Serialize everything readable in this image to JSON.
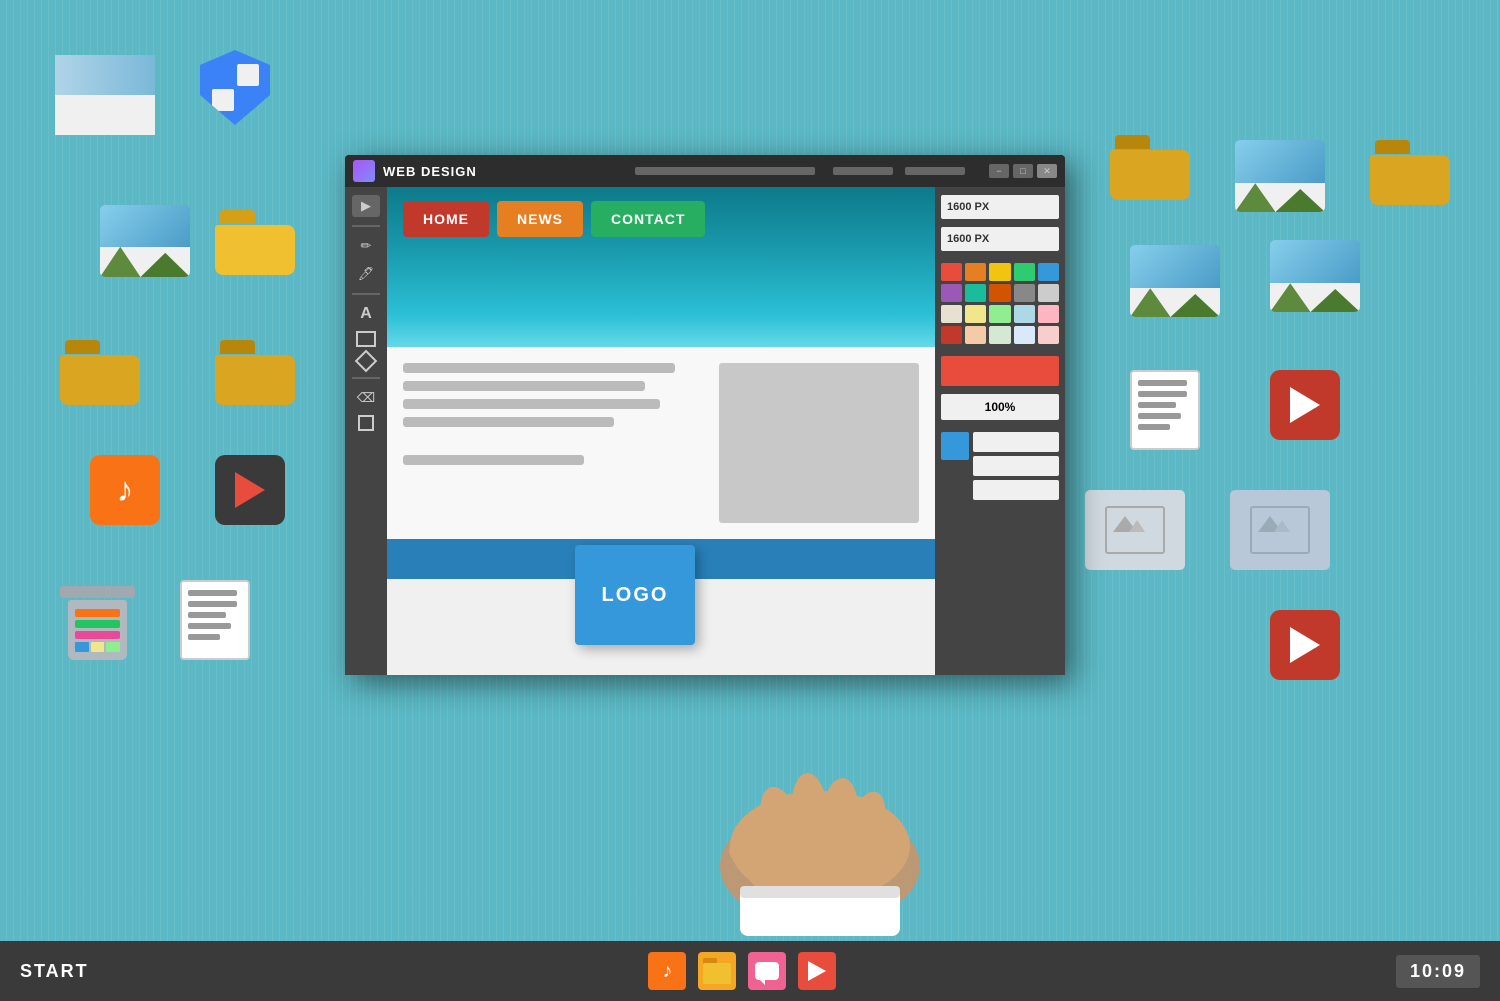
{
  "window": {
    "title": "WEB DESIGN",
    "minimize_label": "−",
    "maximize_label": "□",
    "close_label": "✕"
  },
  "canvas": {
    "width_label": "1600 PX",
    "height_label": "1600 PX",
    "zoom_label": "100%"
  },
  "nav_buttons": {
    "home": "HOME",
    "news": "NEWS",
    "contact": "CONTACT"
  },
  "logo_card": {
    "label": "LOGO"
  },
  "taskbar": {
    "start_label": "START",
    "clock": "10:09"
  },
  "swatches": [
    "#e74c3c",
    "#e67e22",
    "#f1c40f",
    "#2ecc71",
    "#3498db",
    "#9b59b6",
    "#1abc9c",
    "#d35400",
    "#888",
    "#ccc",
    "#e8e0d0",
    "#f0e68c",
    "#90ee90",
    "#add8e6",
    "#ffb6c1",
    "#c0392b",
    "#e74c3c",
    "#e67e22",
    "#f39c12",
    "#f1c40f"
  ],
  "icons": {
    "taskbar_music_color": "#f97316",
    "taskbar_folder_color": "#f5a623",
    "taskbar_chat_color": "#f06292",
    "taskbar_play_color": "#e74c3c"
  }
}
